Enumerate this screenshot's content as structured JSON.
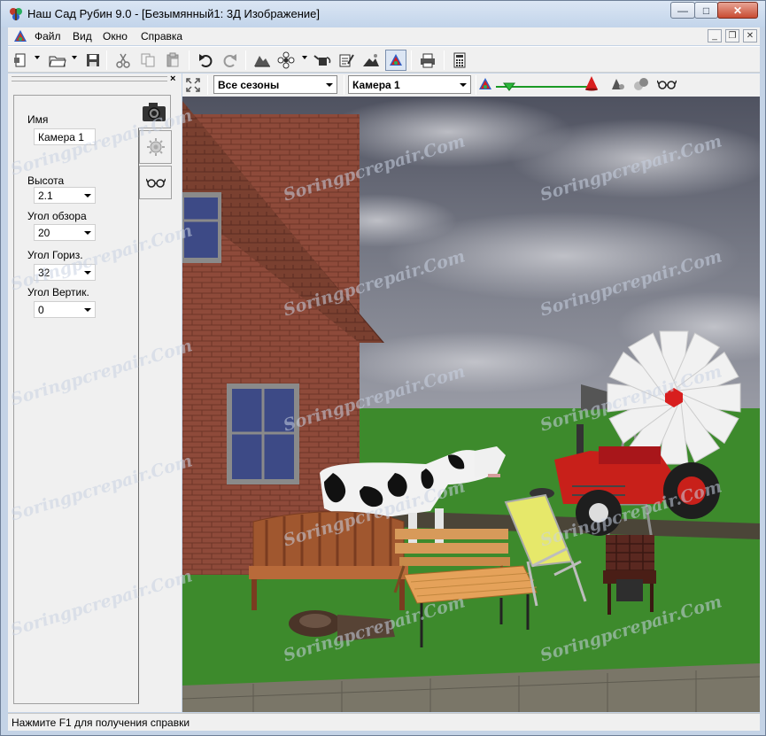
{
  "window": {
    "title": "Наш Сад Рубин 9.0 - [Безымянный1: 3Д Изображение]",
    "min_glyph": "—",
    "max_glyph": "□",
    "close_glyph": "✕"
  },
  "menubar": {
    "items": [
      "Файл",
      "Вид",
      "Окно",
      "Справка"
    ],
    "mdi_min": "_",
    "mdi_restore": "❐",
    "mdi_close": "✕"
  },
  "toolbar2": {
    "season_select": "Все сезоны",
    "camera_select": "Камера 1"
  },
  "dock": {
    "close_glyph": "×"
  },
  "camera_panel": {
    "name_label": "Имя",
    "name_value": "Камера 1",
    "height_label": "Высота",
    "height_value": "2.1",
    "fov_label": "Угол обзора",
    "fov_value": "20",
    "hangle_label": "Угол Гориз.",
    "hangle_value": "32",
    "vangle_label": "Угол Вертик.",
    "vangle_value": "0"
  },
  "statusbar": {
    "text": "Нажмите F1 для получения справки"
  },
  "watermark": "Soringpcrepair.Com",
  "colors": {
    "grass": "#3d8a2c",
    "sky": "#5b5f6e",
    "brick": "#8e4a3a",
    "roof": "#6b3a2c",
    "tractor": "#c8201a",
    "accent_red": "#d81e1e"
  }
}
